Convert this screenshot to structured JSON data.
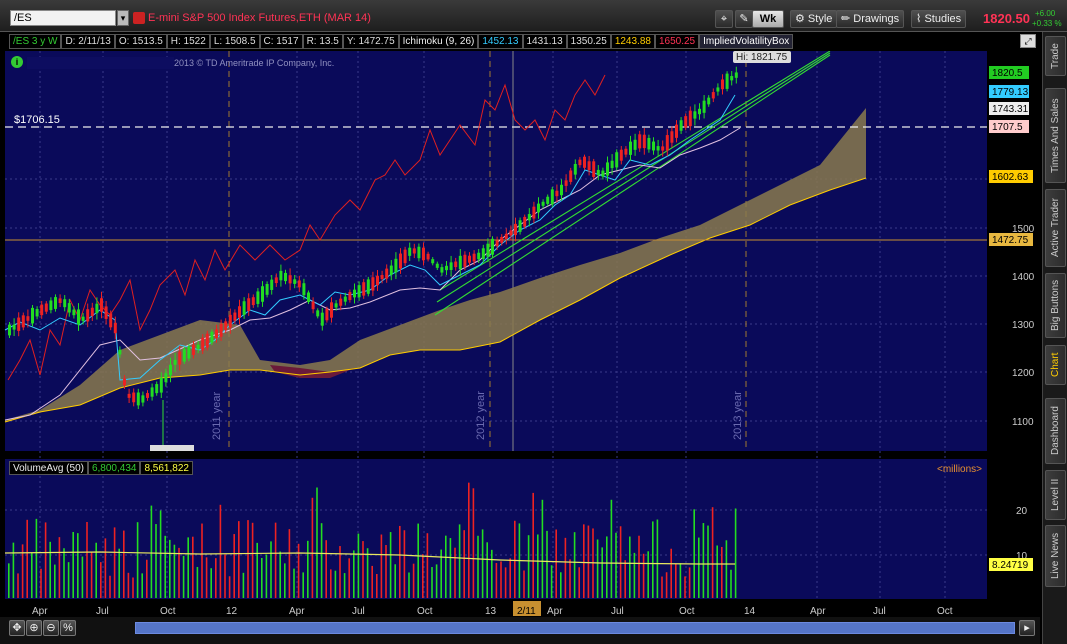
{
  "toolbar": {
    "symbol": "/ES",
    "symbol_desc": "E-mini S&P 500 Index Futures,ETH (MAR 14)",
    "aggregation": "Wk",
    "style_label": "Style",
    "drawings_label": "Drawings",
    "studies_label": "Studies",
    "last_price": "1820.50",
    "change_abs": "+6.00",
    "change_pct": "+0.33 %"
  },
  "studybar": {
    "timeframe": "/ES 3 y W",
    "date": "D: 2/11/13",
    "open": "O: 1513.5",
    "high": "H: 1522",
    "low": "L: 1508.5",
    "close": "C: 1517",
    "range": "R: 13.5",
    "ycl": "Y: 1472.75",
    "ichimoku": "Ichimoku (9, 26)",
    "ich_v1": "1452.13",
    "ich_v2": "1431.13",
    "ich_v3": "1350.25",
    "ich_v4": "1243.88",
    "ich_v5": "1650.25",
    "ivbox": "ImpliedVolatilityBox"
  },
  "copyright": "2013 © TD Ameritrade IP Company, Inc.",
  "price_panel": {
    "hline_label": "$1706.15",
    "hi_label": "Hi: 1821.75",
    "lo_label": "Lo: 1068",
    "y_ticks": [
      "1500",
      "1400",
      "1300",
      "1200",
      "1100"
    ],
    "price_tags": [
      {
        "text": "1820.5",
        "color": "#22cc22"
      },
      {
        "text": "1779.13",
        "color": "#33ccff"
      },
      {
        "text": "1743.31",
        "color": "#eeeeee"
      },
      {
        "text": "1707.5",
        "color": "#ffcccc"
      },
      {
        "text": "1602.63",
        "color": "#ffcc00"
      },
      {
        "text": "1472.75",
        "color": "#e8b840"
      }
    ],
    "year_labels": [
      "2011 year",
      "2012 year",
      "2013 year"
    ]
  },
  "volume_panel": {
    "title": "VolumeAvg (50)",
    "v1": "6,800,434",
    "v2": "8,561,822",
    "units": "<millions>",
    "y_ticks": [
      "20",
      "10"
    ],
    "avg_tag": "8.24719"
  },
  "x_axis": {
    "labels": [
      "Apr",
      "Jul",
      "Oct",
      "12",
      "Apr",
      "Jul",
      "Oct",
      "13",
      "2/11",
      "Apr",
      "Jul",
      "Oct",
      "14",
      "Apr",
      "Jul",
      "Oct"
    ]
  },
  "right_tabs": [
    "Trade",
    "Times And Sales",
    "Active Trader",
    "Big Buttons",
    "Chart",
    "Dashboard",
    "Level II",
    "Live News"
  ],
  "bottom": {
    "zoom_pct": "%"
  }
}
